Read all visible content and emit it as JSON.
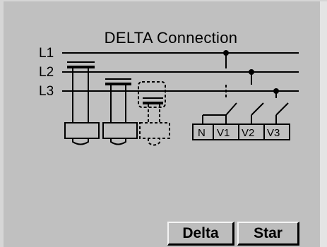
{
  "screen": {
    "title": "DELTA Connection"
  },
  "diagram": {
    "lines": [
      "L1",
      "L2",
      "L3"
    ],
    "terminals": [
      "N",
      "V1",
      "V2",
      "V3"
    ]
  },
  "buttons": {
    "delta_label": "Delta",
    "star_label": "Star"
  },
  "colors": {
    "background": "#c0c0c0",
    "ink": "#000000",
    "button_face": "#bdbdbd"
  }
}
